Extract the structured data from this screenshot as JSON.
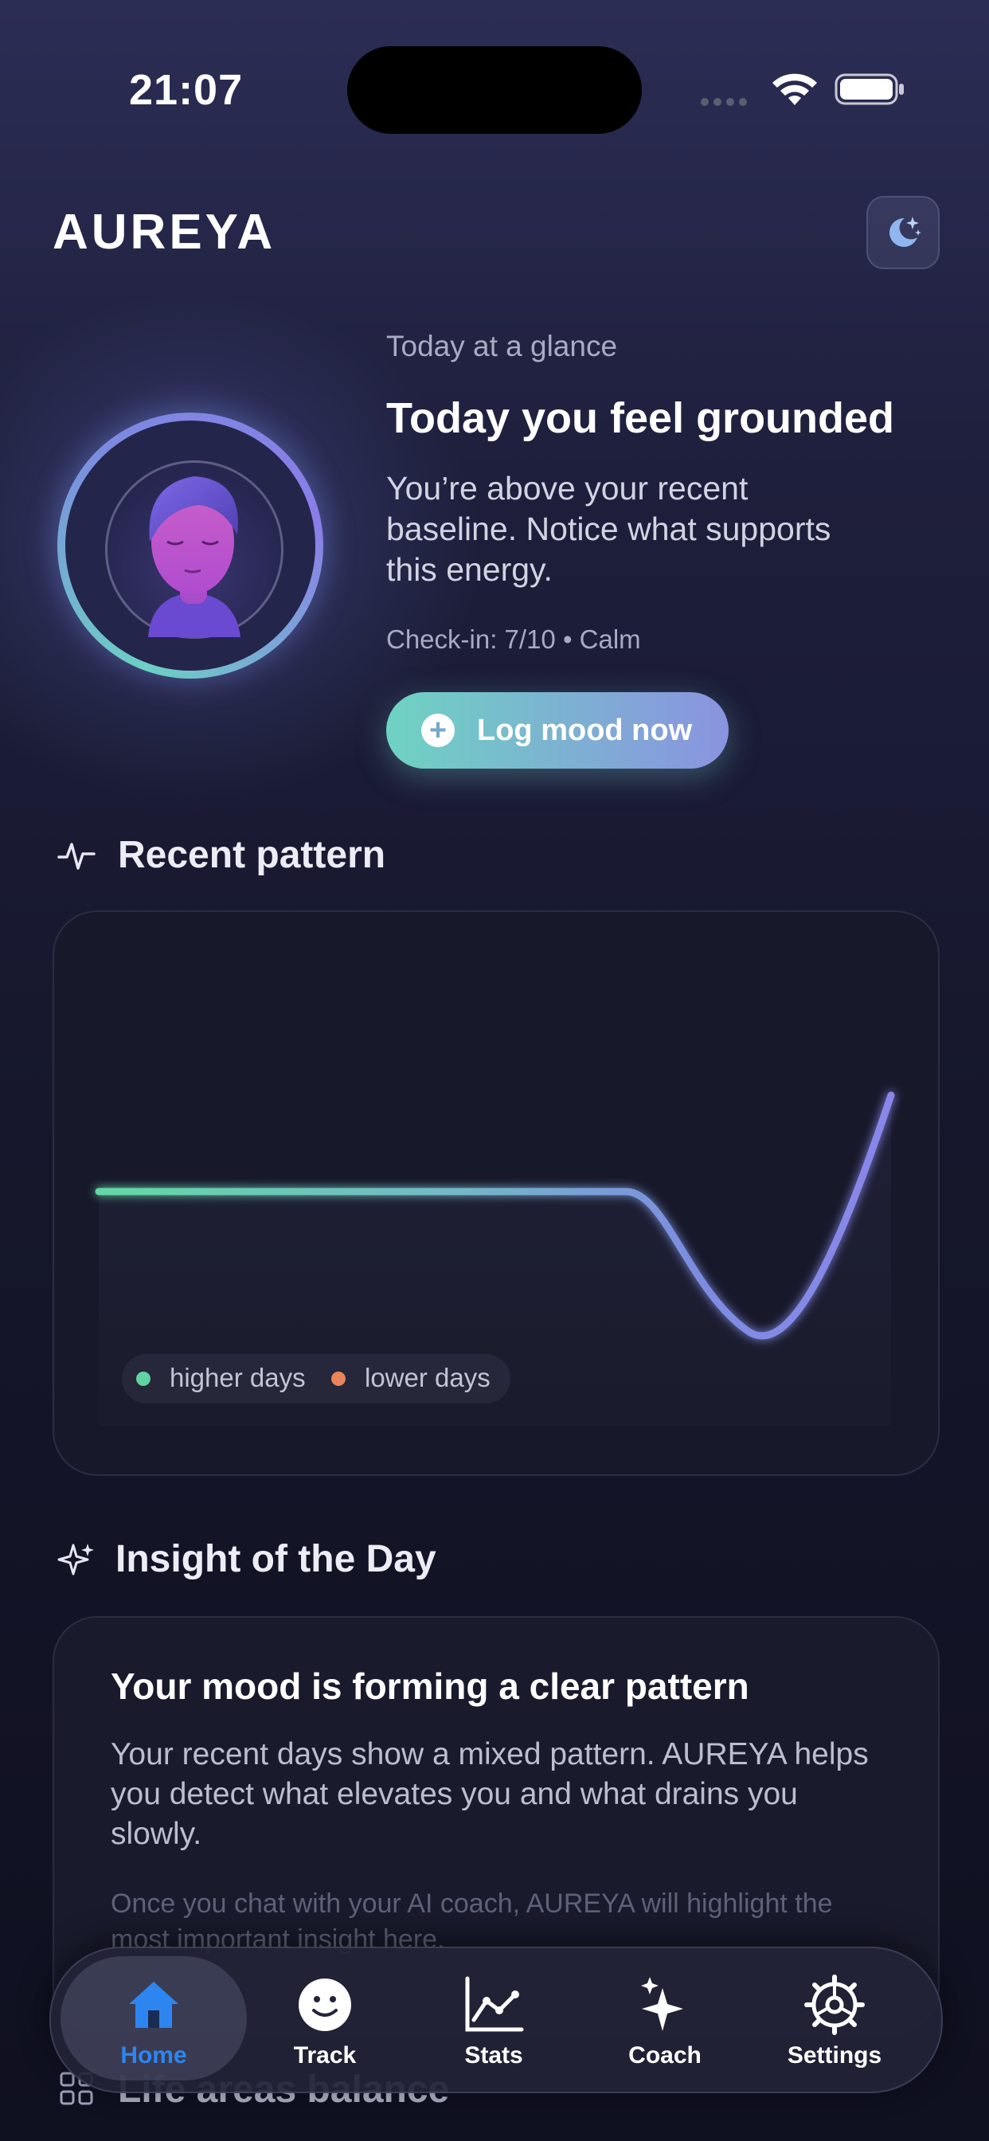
{
  "status_bar": {
    "time": "21:07"
  },
  "header": {
    "brand": "AUREYA",
    "mode_icon": "moon-stars-icon"
  },
  "hero": {
    "eyebrow": "Today at a glance",
    "title": "Today you feel grounded",
    "body": "You’re above your recent baseline. Notice what supports this energy.",
    "meta": "Check-in: 7/10 • Calm",
    "cta_label": "Log mood now"
  },
  "recent_pattern": {
    "title": "Recent pattern",
    "legend": {
      "higher": {
        "label": "higher days",
        "color": "#5fd3a0"
      },
      "lower": {
        "label": "lower days",
        "color": "#e8855a"
      }
    }
  },
  "insight": {
    "section_title": "Insight of the Day",
    "title": "Your mood is forming a clear pattern",
    "body": "Your recent days show a mixed pattern. AUREYA helps you detect what elevates you and what drains you slowly.",
    "note": "Once you chat with your AI coach, AUREYA will highlight the most important insight here."
  },
  "next_section": {
    "title": "Life areas balance"
  },
  "tabbar": {
    "items": [
      {
        "label": "Home",
        "icon": "home-icon",
        "active": true
      },
      {
        "label": "Track",
        "icon": "smiley-icon",
        "active": false
      },
      {
        "label": "Stats",
        "icon": "stats-chart-icon",
        "active": false
      },
      {
        "label": "Coach",
        "icon": "sparkles-icon",
        "active": false
      },
      {
        "label": "Settings",
        "icon": "gear-icon",
        "active": false
      }
    ]
  },
  "colors": {
    "accent_teal": "#6ed3c2",
    "accent_indigo": "#8a93e0",
    "active_tab": "#2d86f0"
  }
}
